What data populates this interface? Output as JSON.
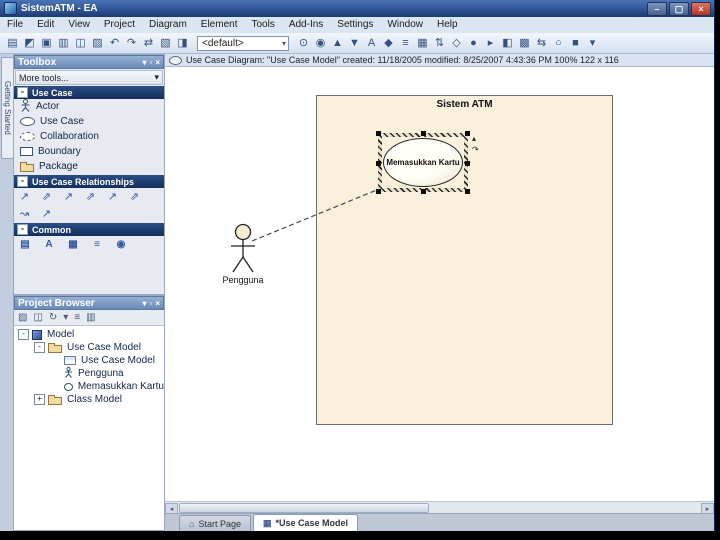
{
  "window": {
    "title": "SistemATM - EA",
    "controls": {
      "minimize": "–",
      "maximize": "▢",
      "close": "×"
    }
  },
  "menu": {
    "items": [
      "File",
      "Edit",
      "View",
      "Project",
      "Diagram",
      "Element",
      "Tools",
      "Add-Ins",
      "Settings",
      "Window",
      "Help"
    ]
  },
  "toolbar": {
    "combo_value": "<default>",
    "icons_left": [
      "▤",
      "◩",
      "▣",
      "▥",
      "◫",
      "▨",
      "↶",
      "↷",
      "⇄",
      "▧",
      "◨"
    ],
    "icons_right": [
      "⊙",
      "◉",
      "▲",
      "▼",
      "A",
      "◆",
      "≡",
      "▦",
      "⇅",
      "◇",
      "●",
      "▸",
      "◧",
      "▩",
      "⇆",
      "○",
      "■",
      "▾"
    ]
  },
  "ui_icons": {
    "chevron_down": "▾",
    "pin": "▫",
    "close": "×",
    "collapse": "-",
    "expand": "+",
    "scroll_left": "◂",
    "scroll_right": "▸",
    "quicklink_up": "▴",
    "quicklink_arrow": "↷"
  },
  "left_dock": {
    "tab_label": "Getting Started"
  },
  "toolbox": {
    "title": "Toolbox",
    "more_tools": "More tools...",
    "sections": {
      "use_case": {
        "label": "Use Case",
        "items": [
          {
            "label": "Actor"
          },
          {
            "label": "Use Case"
          },
          {
            "label": "Collaboration"
          },
          {
            "label": "Boundary"
          },
          {
            "label": "Package"
          }
        ]
      },
      "relationships": {
        "label": "Use Case Relationships",
        "icons_row1": [
          "↗",
          "⇗",
          "↗",
          "⇗",
          "↗",
          "⇗"
        ],
        "icons_row2": [
          "↝",
          "↗"
        ]
      },
      "common": {
        "label": "Common",
        "icons": [
          "▤",
          "A",
          "▦",
          "≡",
          "◉"
        ]
      }
    }
  },
  "project_browser": {
    "title": "Project Browser",
    "toolbar_icons": [
      "▧",
      "◫",
      "↻",
      "▾",
      "≡",
      "▥"
    ],
    "tree": [
      {
        "label": "Model"
      },
      {
        "label": "Use Case Model"
      },
      {
        "label": "Use Case Model"
      },
      {
        "label": "Pengguna"
      },
      {
        "label": "Memasukkan Kartu"
      },
      {
        "label": "Class Model"
      }
    ]
  },
  "diagram_caption": {
    "text": "Use Case Diagram: \"Use Case Model\"  created: 11/18/2005  modified: 8/25/2007 4:43:36 PM  100%  122 x 116"
  },
  "canvas": {
    "frame_title": "Sistem ATM",
    "usecase_label": "Memasukkan Kartu",
    "actor_label": "Pengguna"
  },
  "tabs": {
    "items": [
      {
        "label": "Start Page",
        "icon": "⌂"
      },
      {
        "label": "*Use Case Model",
        "icon": "▦"
      }
    ]
  },
  "colors": {
    "titlebar": "#1c3a74",
    "section_header": "#142f5c",
    "paper": "#faf0dc"
  }
}
